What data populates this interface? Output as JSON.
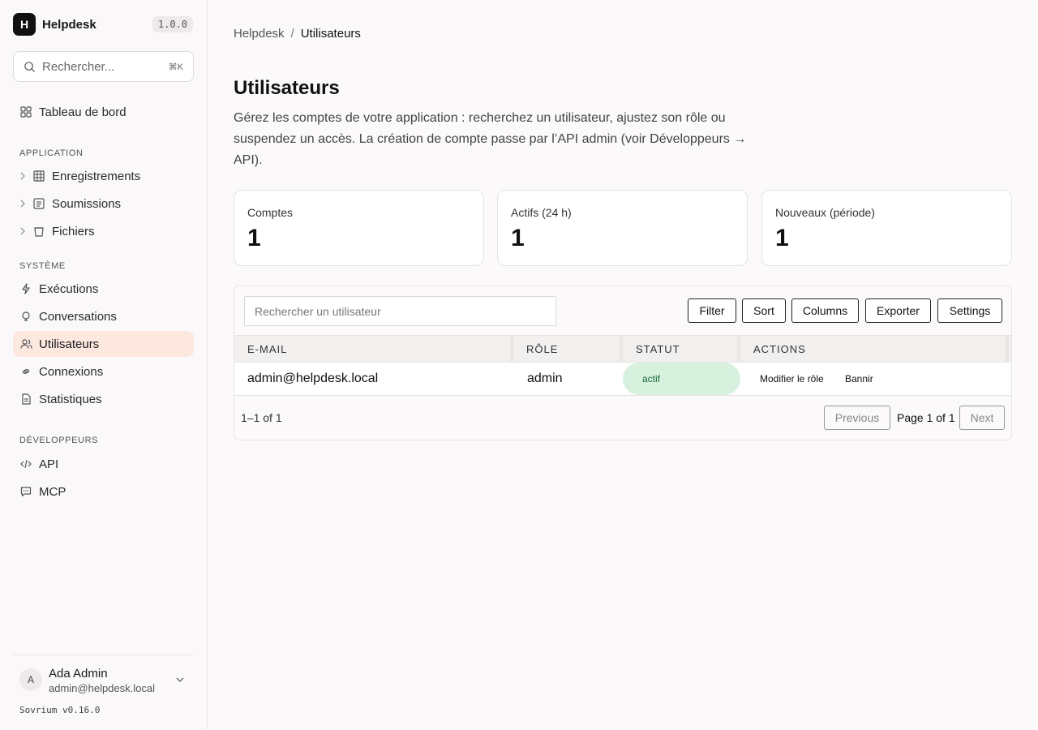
{
  "app": {
    "logo_letter": "H",
    "name": "Helpdesk",
    "version": "1.0.0"
  },
  "search": {
    "placeholder": "Rechercher...",
    "shortcut": "⌘K"
  },
  "nav": {
    "dashboard": "Tableau de bord",
    "sections": {
      "application": "APPLICATION",
      "system": "SYSTÈME",
      "developers": "DÉVELOPPEURS"
    },
    "application_items": [
      "Enregistrements",
      "Soumissions",
      "Fichiers"
    ],
    "system_items": [
      "Exécutions",
      "Conversations",
      "Utilisateurs",
      "Connexions",
      "Statistiques"
    ],
    "developer_items": [
      "API",
      "MCP"
    ],
    "active": "Utilisateurs"
  },
  "user": {
    "initial": "A",
    "name": "Ada Admin",
    "email": "admin@helpdesk.local"
  },
  "footer": {
    "version": "Sovrium v0.16.0"
  },
  "breadcrumb": {
    "root": "Helpdesk",
    "separator": "/",
    "current": "Utilisateurs"
  },
  "page": {
    "title": "Utilisateurs",
    "description": "Gérez les comptes de votre application : recherchez un utilisateur, ajustez son rôle ou suspendez un accès. La création de compte passe par l’API admin (voir Développeurs → API)."
  },
  "stats": [
    {
      "label": "Comptes",
      "value": "1"
    },
    {
      "label": "Actifs (24 h)",
      "value": "1"
    },
    {
      "label": "Nouveaux (période)",
      "value": "1"
    }
  ],
  "table": {
    "search_placeholder": "Rechercher un utilisateur",
    "toolbar": {
      "filter": "Filter",
      "sort": "Sort",
      "columns": "Columns",
      "export": "Exporter",
      "settings": "Settings"
    },
    "headers": [
      "E-MAIL",
      "RÔLE",
      "STATUT",
      "ACTIONS"
    ],
    "rows": [
      {
        "email": "admin@helpdesk.local",
        "role": "admin",
        "status": "actif",
        "actions": [
          "Modifier le rôle",
          "Bannir"
        ]
      }
    ],
    "pagination": {
      "count": "1–1 of 1",
      "previous": "Previous",
      "page_info": "Page 1 of 1",
      "next": "Next"
    }
  },
  "colors": {
    "active_nav_bg": "#fde8df",
    "status_active_bg": "#d8f1df",
    "status_active_text": "#176b34",
    "brand_logo_bg": "#111111"
  }
}
